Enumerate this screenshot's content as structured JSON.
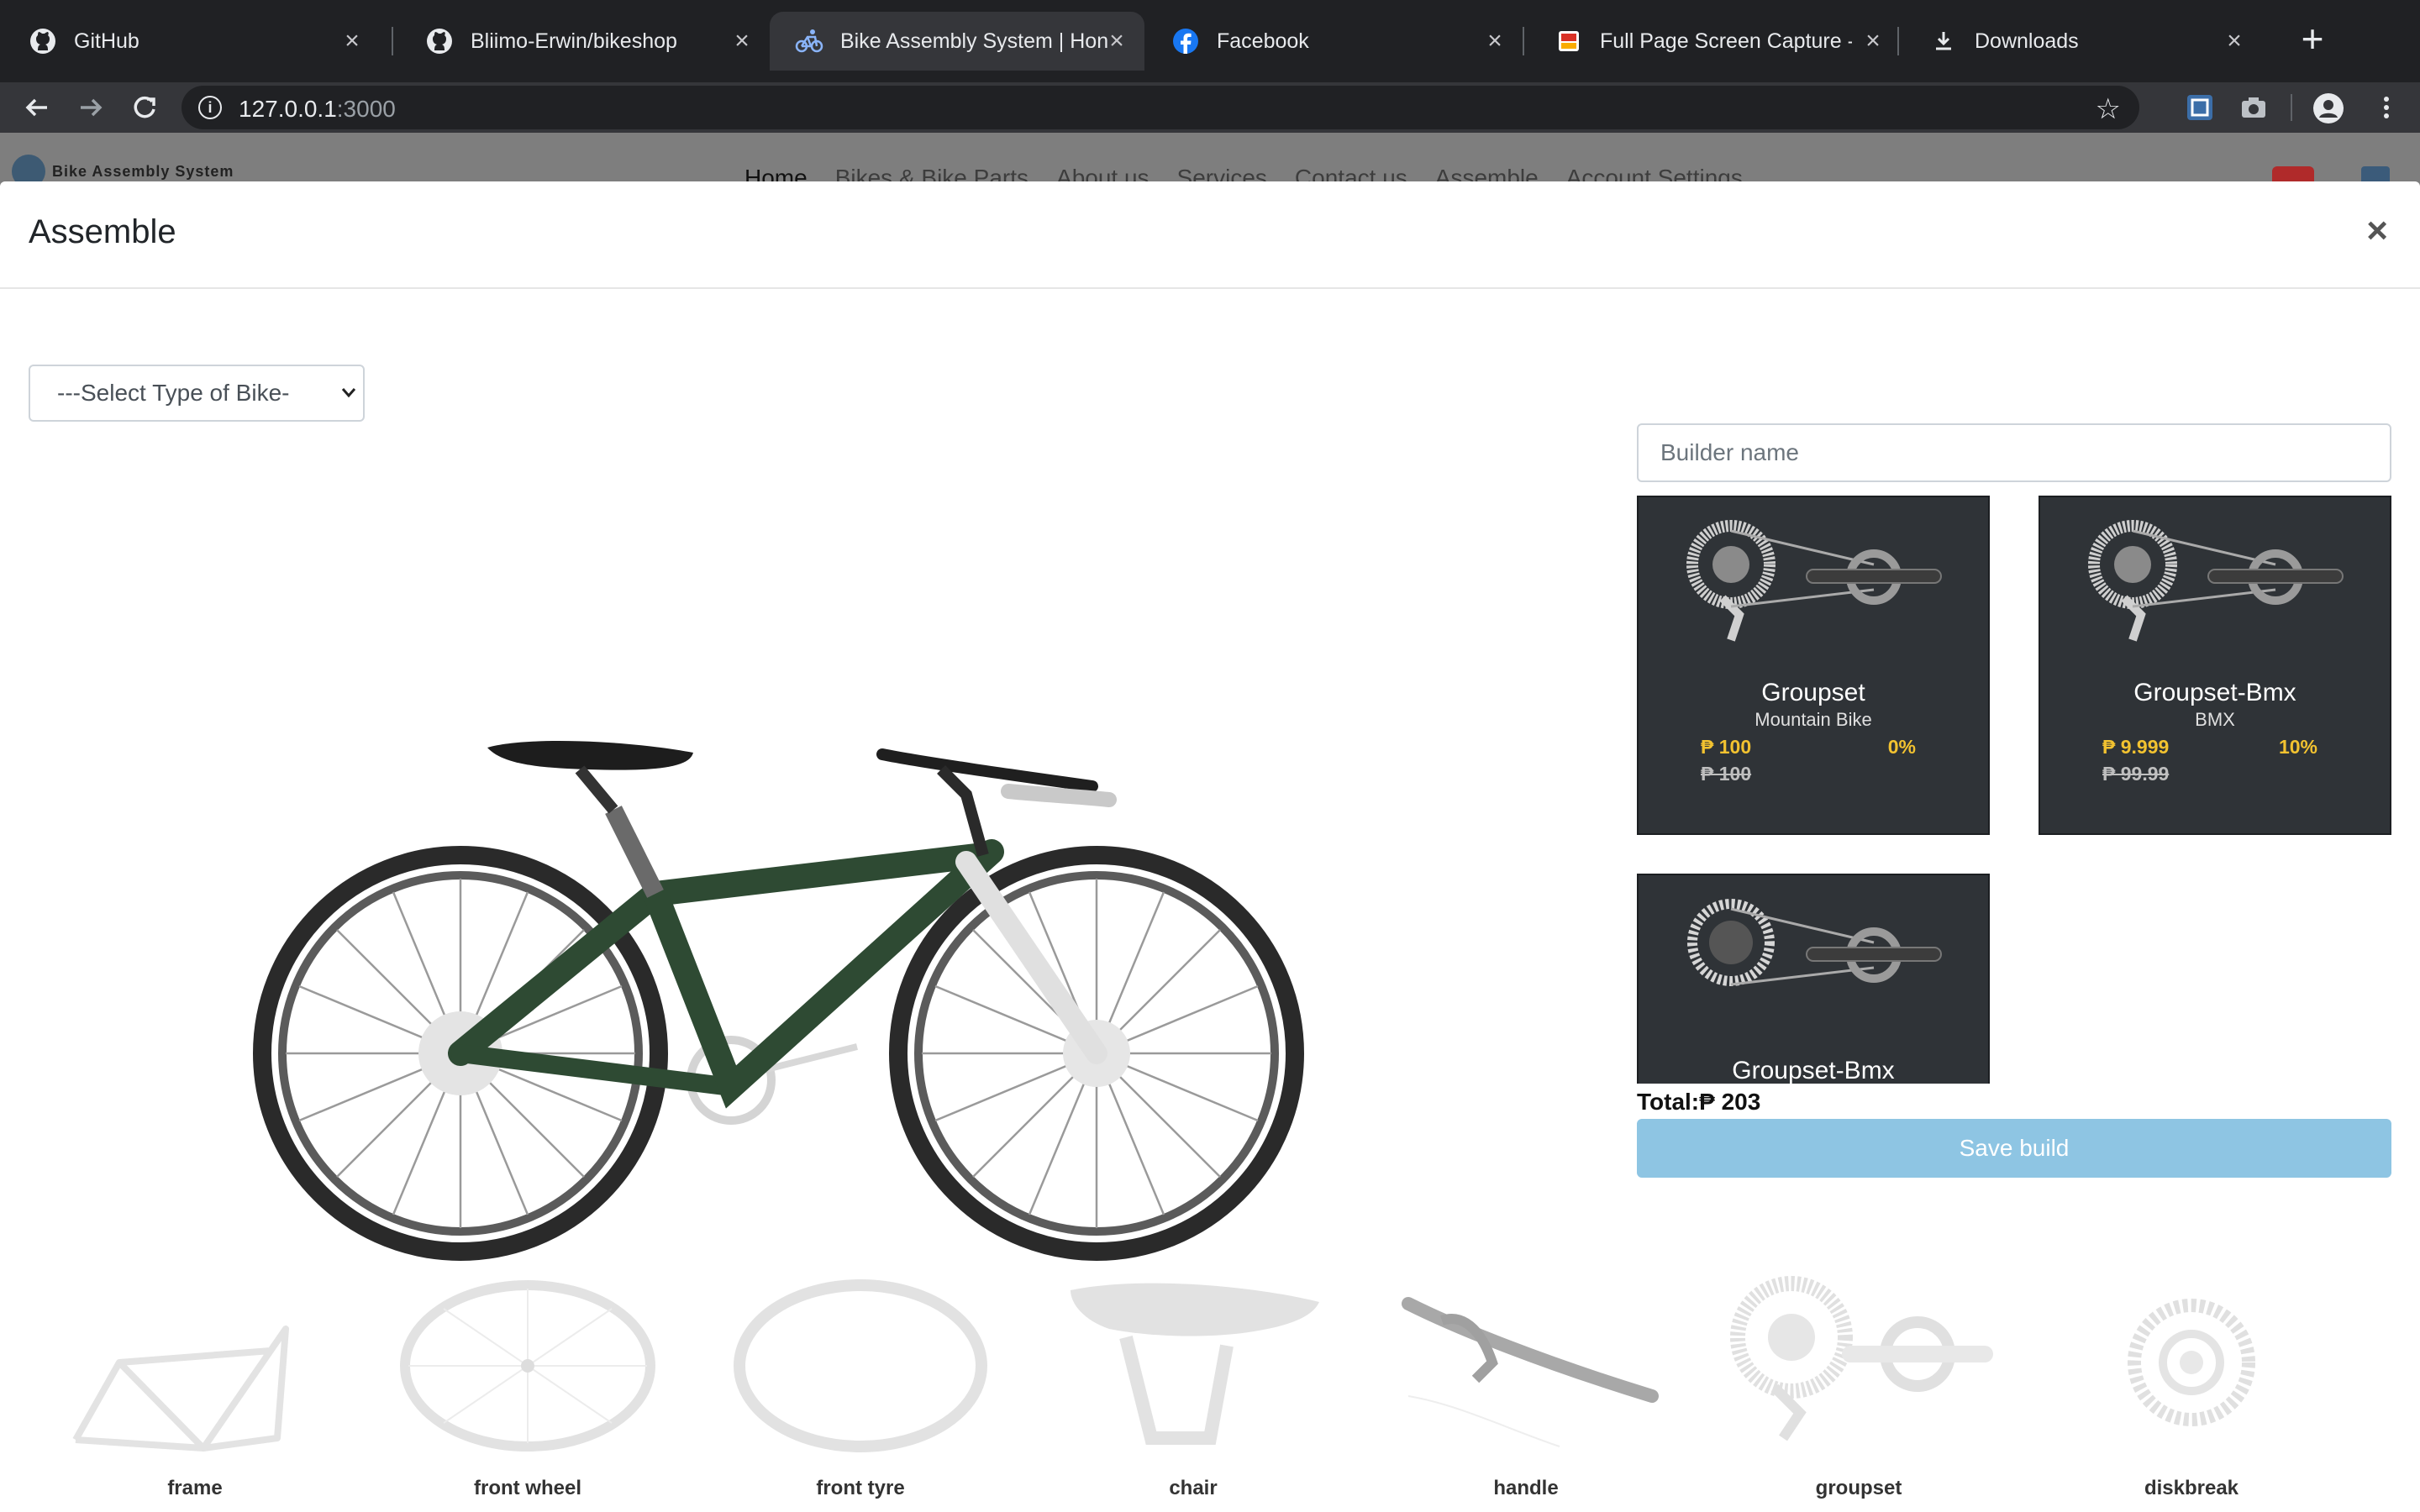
{
  "browser": {
    "tabs": [
      {
        "title": "GitHub",
        "icon": "github-icon"
      },
      {
        "title": "Bliimo-Erwin/bikeshop",
        "icon": "github-icon"
      },
      {
        "title": "Bike Assembly System | Hon",
        "icon": "bike-icon"
      },
      {
        "title": "Facebook",
        "icon": "facebook-icon"
      },
      {
        "title": "Full Page Screen Capture - C",
        "icon": "capture-extension-icon"
      },
      {
        "title": "Downloads",
        "icon": "download-icon"
      }
    ],
    "active_tab": 2,
    "url_host": "127.0.0.1",
    "url_port": ":3000"
  },
  "site": {
    "brand": "Bike Assembly System",
    "nav": [
      "Home",
      "Bikes & Bike Parts",
      "About us",
      "Services",
      "Contact us",
      "Assemble",
      "Account Settings"
    ]
  },
  "modal": {
    "title": "Assemble",
    "close": "×",
    "select_placeholder": "---Select Type of Bike-",
    "builder_placeholder": "Builder name",
    "parts": [
      {
        "name": "Groupset",
        "type": "Mountain Bike",
        "price": "₱ 100",
        "discount": "0%",
        "original": "₱ 100"
      },
      {
        "name": "Groupset-Bmx",
        "type": "BMX",
        "price": "₱ 9.999",
        "discount": "10%",
        "original": "₱ 99.99"
      },
      {
        "name": "Groupset-Bmx",
        "type": "",
        "price": "",
        "discount": "",
        "original": ""
      }
    ],
    "total": "Total:₱ 203",
    "save_label": "Save build",
    "slots": [
      "frame",
      "front wheel",
      "front tyre",
      "chair",
      "handle",
      "groupset",
      "diskbreak"
    ]
  },
  "colors": {
    "card_bg": "#2f3337",
    "price": "#f2c230",
    "save_button": "#8ec5e3",
    "frame_green": "#2e4a33"
  }
}
